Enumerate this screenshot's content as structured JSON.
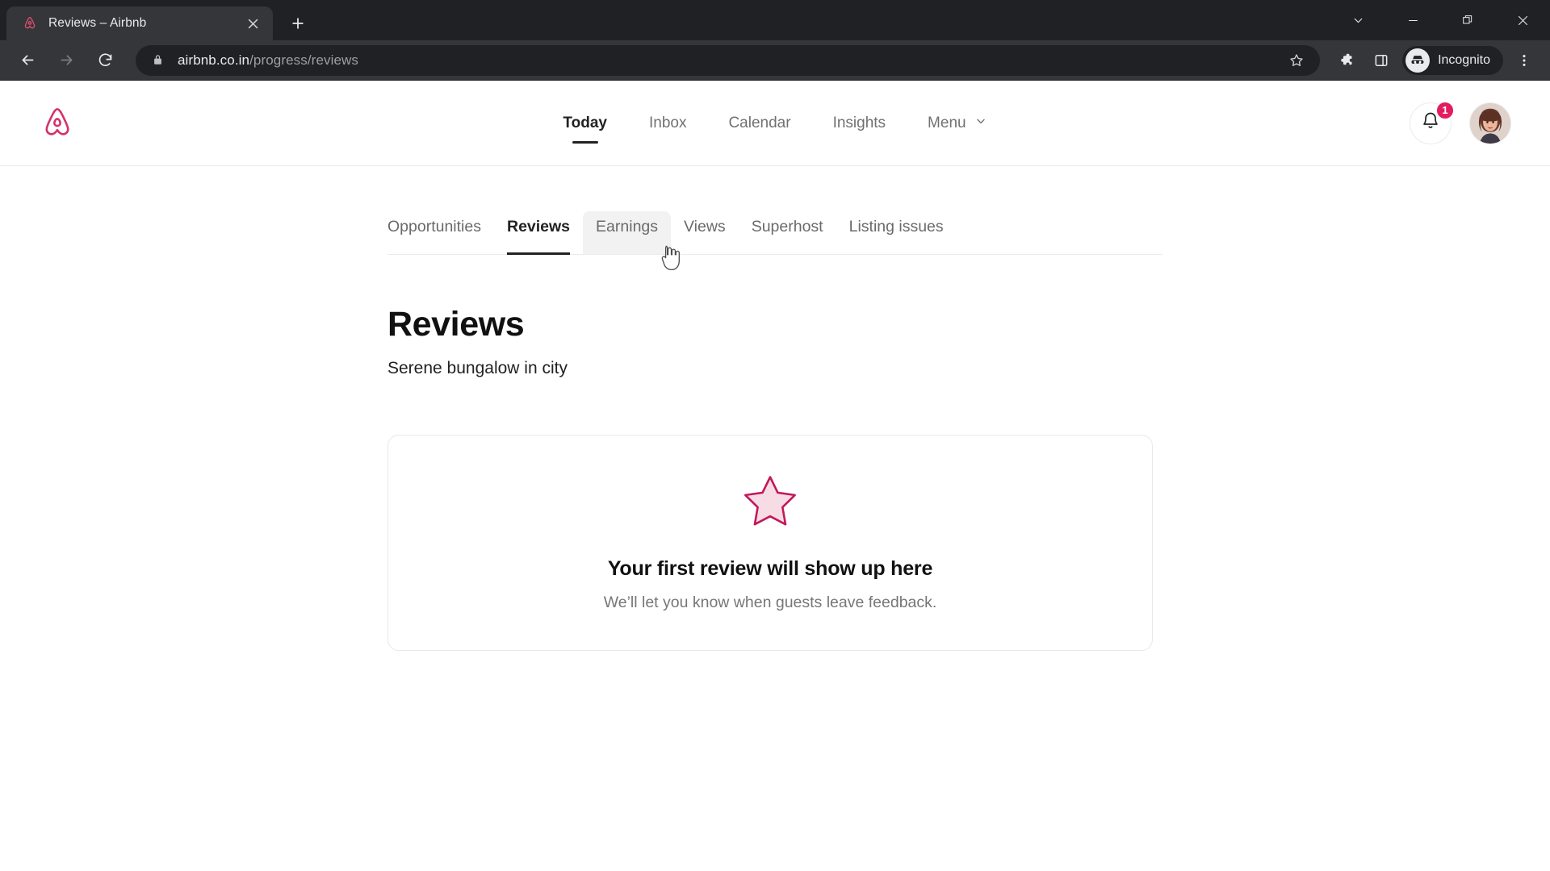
{
  "browser": {
    "tab": {
      "title": "Reviews – Airbnb",
      "favicon_name": "airbnb-favicon",
      "close_label": "×"
    },
    "new_tab_label": "+",
    "window_controls": [
      {
        "name": "minimize-to-tray-button",
        "glyph": "⌄"
      },
      {
        "name": "minimize-button",
        "glyph": "—"
      },
      {
        "name": "restore-button",
        "glyph": "❐"
      },
      {
        "name": "close-window-button",
        "glyph": "✕"
      }
    ],
    "nav": {
      "back_label": "←",
      "forward_label": "→",
      "reload_label": "⟳"
    },
    "omnibox": {
      "host": "airbnb.co.in",
      "path": "/progress/reviews",
      "lock_icon": "lock-icon",
      "bookmark_icon": "star-icon"
    },
    "toolbar_icons": [
      {
        "name": "extensions-icon",
        "glyph": "puzzle"
      },
      {
        "name": "side-panel-icon",
        "glyph": "panel"
      }
    ],
    "profile": {
      "label": "Incognito",
      "icon": "incognito-icon"
    },
    "menu_icon": "kebab-menu-icon"
  },
  "header": {
    "logo_name": "airbnb-logo",
    "nav_items": [
      {
        "label": "Today",
        "active": true
      },
      {
        "label": "Inbox",
        "active": false
      },
      {
        "label": "Calendar",
        "active": false
      },
      {
        "label": "Insights",
        "active": false
      },
      {
        "label": "Menu",
        "active": false,
        "has_chevron": true
      }
    ],
    "notifications": {
      "icon": "bell-icon",
      "count": "1"
    },
    "avatar_name": "user-avatar"
  },
  "subtabs": [
    {
      "label": "Opportunities",
      "state": "default"
    },
    {
      "label": "Reviews",
      "state": "active"
    },
    {
      "label": "Earnings",
      "state": "hovered"
    },
    {
      "label": "Views",
      "state": "default"
    },
    {
      "label": "Superhost",
      "state": "default"
    },
    {
      "label": "Listing issues",
      "state": "default"
    }
  ],
  "main": {
    "title": "Reviews",
    "subtitle": "Serene bungalow in city",
    "empty_state": {
      "icon": "star-icon",
      "heading": "Your first review will show up here",
      "description": "We’ll let you know when guests leave feedback."
    }
  },
  "colors": {
    "brand": "#e31c5f",
    "star_stroke": "#c2185b",
    "star_fill": "#f7dce6",
    "text_primary": "#222222",
    "text_secondary": "#717171"
  }
}
